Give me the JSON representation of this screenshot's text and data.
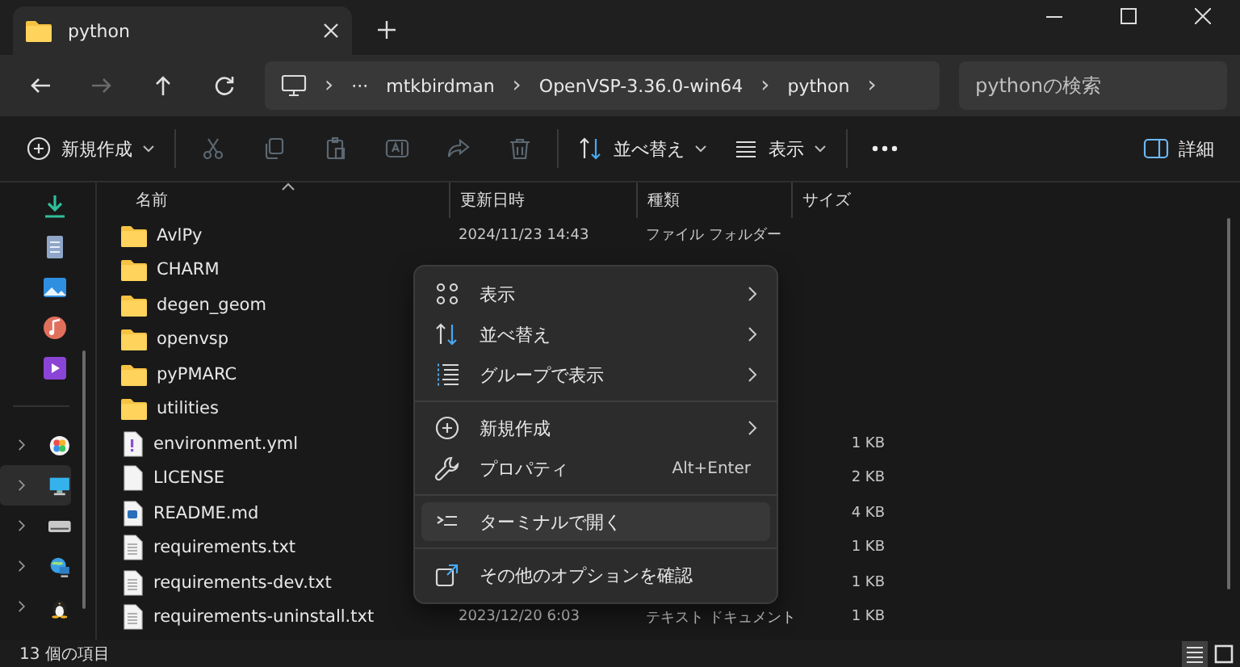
{
  "tabs": [
    {
      "title": "python",
      "selected": true
    }
  ],
  "nav": [
    {
      "kind": "back",
      "disabled": false
    },
    {
      "kind": "forward",
      "disabled": true
    },
    {
      "kind": "up",
      "disabled": false
    },
    {
      "kind": "refresh",
      "disabled": false
    }
  ],
  "address": {
    "separator": "›",
    "ellipsis": "···",
    "crumbs": [
      "mtkbirdman",
      "OpenVSP-3.36.0-win64",
      "python"
    ]
  },
  "search": {
    "placeholder": "pythonの検索"
  },
  "toolbar": {
    "new_label": "新規作成",
    "actions": [
      {
        "kind": "cut",
        "disabled": true
      },
      {
        "kind": "copy",
        "disabled": true
      },
      {
        "kind": "paste",
        "disabled": true
      },
      {
        "kind": "rename",
        "disabled": true
      },
      {
        "kind": "share",
        "disabled": true
      },
      {
        "kind": "delete",
        "disabled": true
      }
    ],
    "sort_label": "並べ替え",
    "view_label": "表示",
    "details_label": "詳細"
  },
  "sidebar": {
    "pinned": [
      {
        "kind": "downloads"
      },
      {
        "kind": "documents"
      },
      {
        "kind": "pictures"
      },
      {
        "kind": "music"
      },
      {
        "kind": "videos"
      }
    ],
    "tree": [
      {
        "kind": "photos",
        "selected": false
      },
      {
        "kind": "desktop",
        "selected": true
      },
      {
        "kind": "drive",
        "selected": false
      },
      {
        "kind": "network",
        "selected": false
      },
      {
        "kind": "linux",
        "selected": false
      }
    ]
  },
  "columns": [
    "名前",
    "更新日時",
    "種類",
    "サイズ"
  ],
  "rows": [
    {
      "kind": "folder",
      "name": "AvlPy",
      "modified": "2024/11/23 14:43",
      "type": "ファイル フォルダー"
    },
    {
      "kind": "folder",
      "name": "CHARM"
    },
    {
      "kind": "folder",
      "name": "degen_geom"
    },
    {
      "kind": "folder",
      "name": "openvsp"
    },
    {
      "kind": "folder",
      "name": "pyPMARC"
    },
    {
      "kind": "folder",
      "name": "utilities"
    },
    {
      "kind": "yml",
      "name": "environment.yml",
      "size": "1 KB"
    },
    {
      "kind": "blank",
      "name": "LICENSE",
      "size": "2 KB"
    },
    {
      "kind": "md",
      "name": "README.md",
      "size": "4 KB"
    },
    {
      "kind": "text",
      "name": "requirements.txt",
      "size": "1 KB"
    },
    {
      "kind": "text",
      "name": "requirements-dev.txt",
      "size": "1 KB"
    },
    {
      "kind": "text",
      "name": "requirements-uninstall.txt",
      "modified": "2023/12/20 6:03",
      "type": "テキスト ドキュメント",
      "size": "1 KB"
    }
  ],
  "context_menu": [
    [
      {
        "kind": "view",
        "label": "表示",
        "submenu": true,
        "selected": false
      },
      {
        "kind": "sort",
        "label": "並べ替え",
        "submenu": true,
        "selected": false
      },
      {
        "kind": "group",
        "label": "グループで表示",
        "submenu": true,
        "selected": false
      }
    ],
    [
      {
        "kind": "new",
        "label": "新規作成",
        "submenu": true,
        "selected": false
      },
      {
        "kind": "properties",
        "label": "プロパティ",
        "shortcut": "Alt+Enter",
        "submenu": false,
        "selected": false
      }
    ],
    [
      {
        "kind": "terminal",
        "label": "ターミナルで開く",
        "submenu": false,
        "selected": true
      }
    ],
    [
      {
        "kind": "more",
        "label": "その他のオプションを確認",
        "submenu": false,
        "selected": false
      }
    ]
  ],
  "status": "13 個の項目",
  "view_buttons": [
    {
      "kind": "details",
      "selected": true
    },
    {
      "kind": "tiles",
      "selected": false
    }
  ]
}
